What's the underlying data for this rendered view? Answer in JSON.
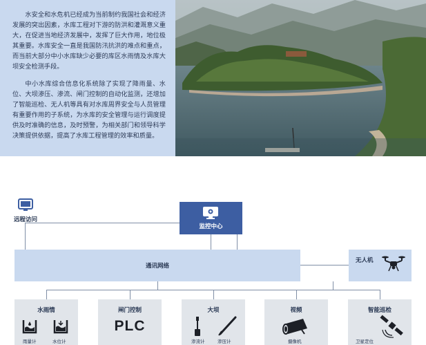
{
  "intro": {
    "paragraph1": "水安全和水危机已经成为当前制约我国社会和经济发展的突出因素，水库工程对下游的防洪和灌溉意义重大，在促进当地经济发展中，发挥了巨大作用，地位极其重要。水库安全一直是我国防汛抗洪的难点和重点，而当前大部分中小水库缺少必要的库区水雨情及水库大坝安全检测手段。",
    "paragraph2": "中小水库综合信息化系统除了实现了降雨量、水位、大坝渗压、渗流、闸门控制的自动化监测，还增加了智能巡检、无人机等具有对水库周界安全与人员管理有重要作用的子系统，为水库的安全管理与运行调度提供及时准确的信息，及时预警，为相关部门和领导科学决策提供依据，提高了水库工程管理的效率和质量。"
  },
  "diagram": {
    "remote_access": "远程访问",
    "monitoring_center": "监控中心",
    "network": "通讯网络",
    "drone": "无人机",
    "subsystems": [
      {
        "title": "水雨情",
        "captions": [
          "雨量计",
          "水位计"
        ]
      },
      {
        "title": "闸门控制",
        "logo": "PLC"
      },
      {
        "title": "大坝",
        "captions": [
          "渗流计",
          "渗压计"
        ]
      },
      {
        "title": "视频",
        "captions": [
          "摄像机"
        ]
      },
      {
        "title": "智能巡检",
        "captions": [
          "卫星定位"
        ]
      }
    ]
  },
  "colors": {
    "panel": "#c9d9ef",
    "accent": "#3d5ea2",
    "subsystem_bg": "#e1e5ea",
    "line": "#7f8ea6"
  },
  "icons": [
    "monitor-icon",
    "drone-icon",
    "rain-gauge-icon",
    "water-level-icon",
    "seepage-meter-icon",
    "pressure-meter-icon",
    "camera-icon",
    "satellite-icon"
  ]
}
